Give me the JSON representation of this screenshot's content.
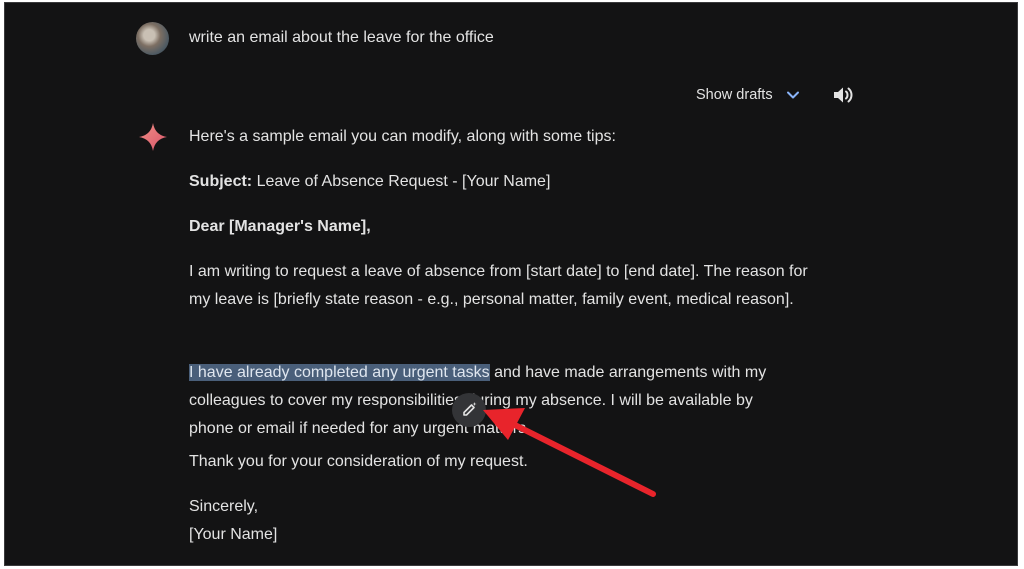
{
  "user": {
    "prompt": "write an email about the leave for the office"
  },
  "toolbar": {
    "show_drafts_label": "Show drafts"
  },
  "response": {
    "intro": "Here's a  sample email you can modify, along with some tips:",
    "subject_label": "Subject:",
    "subject_value": " Leave of Absence Request - [Your Name]",
    "greeting": "Dear [Manager's Name],",
    "body1": "I am writing to request a leave of absence from [start date] to [end date]. The reason for my leave is [briefly state reason - e.g., personal matter, family event, medical reason].",
    "body2_highlight": "I have already completed any urgent tasks",
    "body2_rest": " and have made arrangements with my colleagues to cover my responsibilities during my absence. I will be available by phone or email if needed for any urgent matters.",
    "thanks": "Thank you for your consideration of my request.",
    "closing": "Sincerely,",
    "signature": "[Your Name]"
  },
  "icons": {
    "avatar": "user-avatar",
    "drafts_chevron": "chevron-down-icon",
    "speaker": "speaker-icon",
    "gemini": "gemini-sparkle-icon",
    "edit": "pencil-sparkle-icon",
    "annotation": "red-arrow"
  },
  "colors": {
    "background": "#131314",
    "text": "#e3e3e3",
    "highlight": "#4a5f7a",
    "chevron": "#8ab4f8",
    "arrow": "#e8242b"
  }
}
